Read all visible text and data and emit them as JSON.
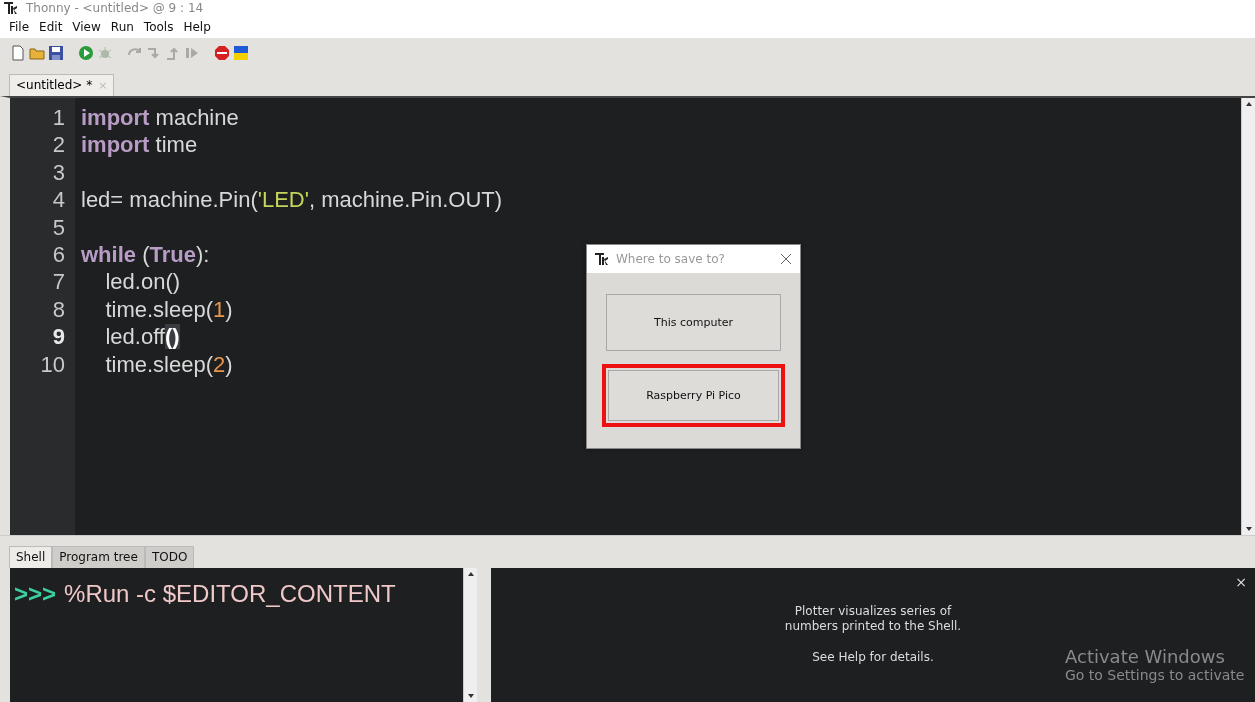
{
  "window": {
    "title": "Thonny  -  <untitled>  @  9 : 14"
  },
  "menu": [
    "File",
    "Edit",
    "View",
    "Run",
    "Tools",
    "Help"
  ],
  "toolbar": [
    {
      "kind": "new",
      "disabled": false
    },
    {
      "kind": "open",
      "disabled": false
    },
    {
      "kind": "save",
      "disabled": false
    },
    {
      "kind": "gap"
    },
    {
      "kind": "run",
      "disabled": false
    },
    {
      "kind": "debug",
      "disabled": true
    },
    {
      "kind": "gap"
    },
    {
      "kind": "step-over",
      "disabled": true
    },
    {
      "kind": "step-into",
      "disabled": true
    },
    {
      "kind": "step-out",
      "disabled": true
    },
    {
      "kind": "resume",
      "disabled": true
    },
    {
      "kind": "gap"
    },
    {
      "kind": "stop",
      "disabled": false
    },
    {
      "kind": "flag"
    }
  ],
  "editor_tabs": [
    {
      "label": "<untitled> *",
      "close": "×",
      "selected": true
    }
  ],
  "code_lines": [
    {
      "number": "1",
      "current": false,
      "tokens": [
        {
          "kind": "keyword",
          "text": "import"
        },
        {
          "kind": "plain",
          "text": " machine"
        }
      ]
    },
    {
      "number": "2",
      "current": false,
      "tokens": [
        {
          "kind": "keyword",
          "text": "import"
        },
        {
          "kind": "plain",
          "text": " time"
        }
      ]
    },
    {
      "number": "3",
      "current": false
    },
    {
      "number": "4",
      "current": false,
      "tokens": [
        {
          "kind": "plain",
          "text": "led= machine.Pin("
        },
        {
          "kind": "string",
          "text": "'LED'"
        },
        {
          "kind": "plain",
          "text": ", machine.Pin.OUT)"
        }
      ]
    },
    {
      "number": "5",
      "current": false
    },
    {
      "number": "6",
      "current": false,
      "tokens": [
        {
          "kind": "keyword",
          "text": "while"
        },
        {
          "kind": "plain",
          "text": " ("
        },
        {
          "kind": "keyword",
          "text": "True"
        },
        {
          "kind": "plain",
          "text": "):"
        }
      ]
    },
    {
      "number": "7",
      "current": false,
      "tokens": [
        {
          "kind": "plain",
          "text": "    led.on()"
        }
      ]
    },
    {
      "number": "8",
      "current": false,
      "tokens": [
        {
          "kind": "plain",
          "text": "    time.sleep("
        },
        {
          "kind": "number",
          "text": "1"
        },
        {
          "kind": "plain",
          "text": ")"
        }
      ]
    },
    {
      "number": "9",
      "current": true,
      "tokens": [
        {
          "kind": "plain",
          "text": "    led.off"
        },
        {
          "kind": "bracket-match",
          "text": "()"
        }
      ]
    },
    {
      "number": "10",
      "current": false,
      "tokens": [
        {
          "kind": "plain",
          "text": "    time.sleep("
        },
        {
          "kind": "number",
          "text": "2"
        },
        {
          "kind": "plain",
          "text": ")"
        }
      ]
    }
  ],
  "bottom_tabs": [
    {
      "label": "Shell",
      "selected": true
    },
    {
      "label": "Program tree",
      "selected": false
    },
    {
      "label": "TODO",
      "selected": false
    }
  ],
  "shell": {
    "prompt": ">>>",
    "command": "%Run -c $EDITOR_CONTENT"
  },
  "plotter": {
    "close": "×",
    "message": [
      "Plotter visualizes series of",
      "numbers printed to the Shell."
    ],
    "hint": "See Help for details."
  },
  "dialog": {
    "title": "Where to save to?",
    "buttons": [
      {
        "label": "This computer",
        "selected": false
      },
      {
        "label": "Raspberry Pi Pico",
        "selected": true
      }
    ]
  },
  "os_overlay": {
    "title": "Activate Windows",
    "subtitle": "Go to Settings to activate"
  }
}
